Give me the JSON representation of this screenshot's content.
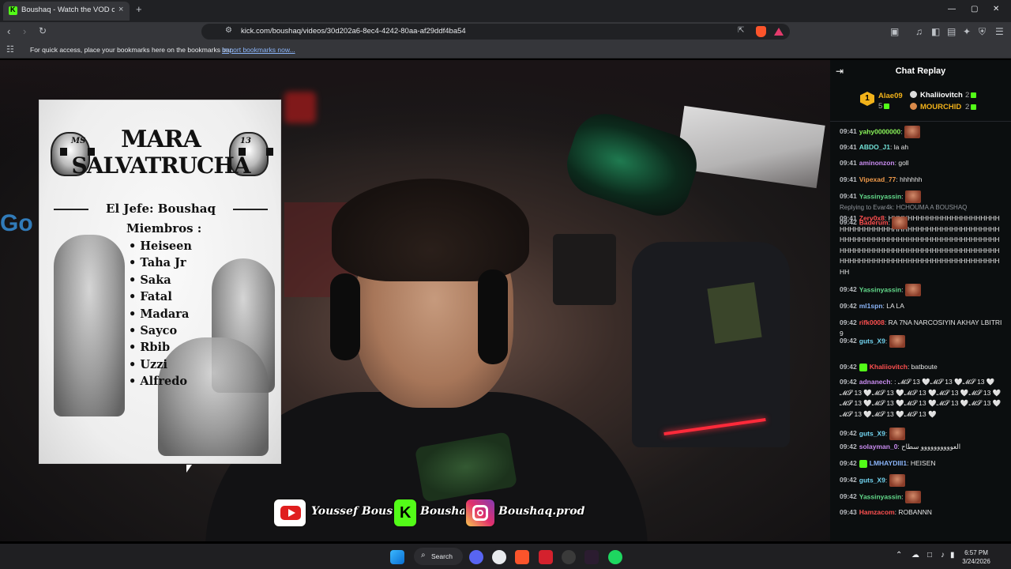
{
  "browser": {
    "tab_title": "Boushaq - Watch the VOD on",
    "tab_close": "×",
    "new_tab": "+",
    "url": "kick.com/boushaq/videos/30d202a6-8ec4-4242-80aa-af29ddf4ba54",
    "bookmarks_message": "For quick access, place your bookmarks here on the bookmarks bar.",
    "bookmarks_link": "Import bookmarks now...",
    "window_controls": {
      "minimize": "—",
      "maximize": "▢",
      "close": "✕"
    },
    "icons": [
      "back-icon",
      "forward-icon",
      "reload-icon",
      "bookmark-icon",
      "site-info-icon",
      "share-icon",
      "brave-shields-icon",
      "brave-rewards-icon",
      "screenshot-icon",
      "media-icon",
      "sidebar-icon",
      "wallet-icon",
      "leo-icon",
      "vpn-icon",
      "menu-icon",
      "apps-icon"
    ]
  },
  "poster": {
    "title_line1": "MARA",
    "title_line2": "SALVATRUCHA",
    "skull_left_label": "MS",
    "skull_right_label": "13",
    "jefe": "El Jefe: Boushaq",
    "miembros_label": "Miembros :",
    "members": [
      "Heiseen",
      "Taha Jr",
      "Saka",
      "Fatal",
      "Madara",
      "Sayco",
      "Rbib",
      "Uzzi",
      "Alfredo"
    ]
  },
  "overlay": {
    "youtube_label": "Youssef Boushaq",
    "kick_label": "Boushaq",
    "instagram_label": "Boushaq.prod"
  },
  "chat": {
    "title": "Chat Replay",
    "leaderboard": [
      {
        "rank": "1",
        "name": "Alae09",
        "count": "5",
        "color": "#f2b21a"
      },
      {
        "name": "Khaliiovitch",
        "count": "2",
        "color": "#ffffff"
      },
      {
        "name": "MOURCHID",
        "count": "2",
        "color": "#f2b21a"
      }
    ],
    "reply_text": "Replying to Evar4k: HCHOUMA A BOUSHAQ",
    "messages": [
      {
        "time": "09:41",
        "user": "yahy0000000",
        "color": "#8bf55a",
        "text": "",
        "emote": true
      },
      {
        "time": "09:41",
        "user": "ABDO_J1",
        "color": "#72e3d8",
        "text": "la ah"
      },
      {
        "time": "09:41",
        "user": "aminonzon",
        "color": "#c98cf0",
        "text": "goll"
      },
      {
        "time": "09:41",
        "user": "Vipexad_77",
        "color": "#f09a4a",
        "text": "hhhhhh"
      },
      {
        "time": "09:41",
        "user": "Yassinyassin",
        "color": "#62d98a",
        "text": "",
        "emote": true
      },
      {
        "time": "09:41",
        "user": "Zerv0x8",
        "color": "#ff5050",
        "text": "HHHHHHHHHHHHHHHHHHHHHHHHHHHHHHHHHHHHHHHHHHHHHHHHHHHHHHHHHHHHHHHHHHHHHHHHHHHHHHHHHHHHHHHHHHHHHHHHHHHHHHHHHHHHHHHHHHHHHHHHHHHHHHHHHHHHHHHHHHHHHHHHHHHHHHHHHHHHH"
      },
      {
        "time": "09:42",
        "user": "Baderum",
        "color": "#ff5050",
        "text": "",
        "emote": true
      },
      {
        "time": "09:42",
        "user": "Yassinyassin",
        "color": "#62d98a",
        "text": "",
        "emote": true
      },
      {
        "time": "09:42",
        "user": "ml1spn",
        "color": "#8ab4f8",
        "text": "LA LA"
      },
      {
        "time": "09:42",
        "user": "rifk0008",
        "color": "#ff5050",
        "text": "RA 7NA NARCOSIYIN AKHAY LBITRI9"
      },
      {
        "time": "09:42",
        "user": "guts_X9",
        "color": "#72d4f0",
        "text": "",
        "emote": true
      },
      {
        "time": "09:42",
        "user": "Khaliiovitch",
        "color": "#ff5050",
        "text": "batboute",
        "badges": true
      },
      {
        "time": "09:42",
        "user": "adnanech",
        "color": "#c98cf0",
        "text": ": 𝓜𝓢 13 🤍𝓜𝓢 13 🤍𝓜𝓢 13 🤍𝓜𝓢 13 🤍𝓜𝓢 13 🤍𝓜𝓢 13 🤍𝓜𝓢 13 🤍𝓜𝓢 13 🤍𝓜𝓢 13 🤍𝓜𝓢 13 🤍𝓜𝓢 13 🤍𝓜𝓢 13 🤍𝓜𝓢 13 🤍𝓜𝓢 13 🤍𝓜𝓢 13 🤍𝓜𝓢 13 🤍"
      },
      {
        "time": "09:42",
        "user": "guts_X9",
        "color": "#72d4f0",
        "text": "",
        "emote": true
      },
      {
        "time": "09:42",
        "user": "solayman_0",
        "color": "#c98cf0",
        "text": "العوووووووووو سطاح"
      },
      {
        "time": "09:42",
        "user": "LMHAYDIII1",
        "color": "#8ab4f8",
        "text": "HEISEN",
        "badges": true
      },
      {
        "time": "09:42",
        "user": "guts_X9",
        "color": "#72d4f0",
        "text": "",
        "emote": true
      },
      {
        "time": "09:42",
        "user": "Yassinyassin",
        "color": "#62d98a",
        "text": "",
        "emote": true
      },
      {
        "time": "09:43",
        "user": "Hamzacom",
        "color": "#ff5050",
        "text": "ROBANNN"
      }
    ]
  },
  "taskbar": {
    "search_label": "Search",
    "time": "6:57 PM",
    "date": "3/24/2026",
    "apps": [
      "windows-start-icon",
      "search-icon",
      "discord-icon",
      "github-icon",
      "brave-icon",
      "adobe-icon",
      "obs-icon",
      "capcut-icon",
      "spotify-icon"
    ],
    "tray_icons": [
      "chevron-up-icon",
      "cloud-icon",
      "network-icon",
      "volume-icon",
      "battery-icon"
    ]
  }
}
